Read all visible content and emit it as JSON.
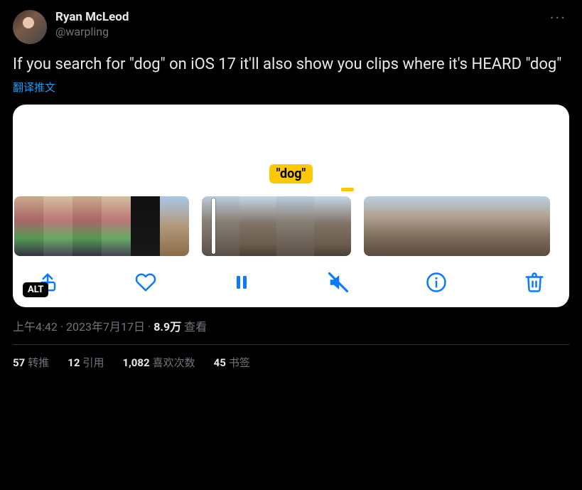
{
  "author": {
    "display_name": "Ryan McLeod",
    "handle": "@warpling"
  },
  "tweet_text": "If you search for \"dog\" on iOS 17 it'll also show you clips where it's HEARD \"dog\"",
  "translate_label": "翻译推文",
  "media": {
    "highlight_tag": "\"dog\"",
    "alt_badge": "ALT",
    "toolbar": {
      "share": "share",
      "like": "like",
      "pause": "pause",
      "mute": "mute",
      "info": "info",
      "trash": "trash"
    }
  },
  "meta": {
    "time": "上午4:42",
    "date": "2023年7月17日",
    "views_number": "8.9万",
    "views_label": "查看"
  },
  "stats": {
    "retweets_num": "57",
    "retweets_label": "转推",
    "quotes_num": "12",
    "quotes_label": "引用",
    "likes_num": "1,082",
    "likes_label": "喜欢次数",
    "bookmarks_num": "45",
    "bookmarks_label": "书签"
  }
}
